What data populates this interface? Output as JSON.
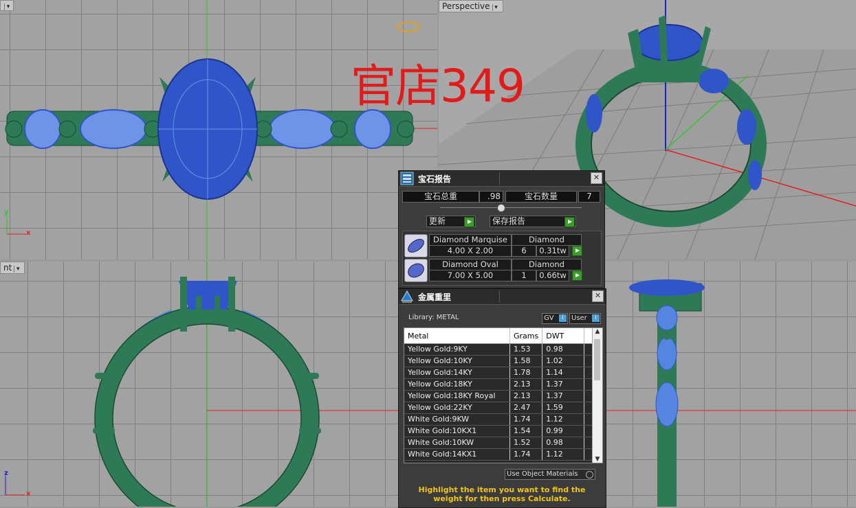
{
  "watermark": "官店349",
  "viewports": {
    "perspective_label": "Perspective",
    "front_label": "nt",
    "axis_x": "x",
    "axis_y": "y",
    "axis_z": "z"
  },
  "gem_report": {
    "title": "宝石报告",
    "total_weight_label": "宝石总重",
    "total_weight_value": ".98",
    "count_label": "宝石数量",
    "count_value": "7",
    "update_label": "更新",
    "save_label": "保存报告",
    "gems": [
      {
        "name": "Diamond Marquise",
        "material": "Diamond",
        "size": "4.00 X 2.00",
        "qty": "6",
        "weight": "0.31tw"
      },
      {
        "name": "Diamond Oval",
        "material": "Diamond",
        "size": "7.00 X 5.00",
        "qty": "1",
        "weight": "0.66tw"
      }
    ]
  },
  "metal_weight": {
    "title": "金属重里",
    "library_label": "Library: METAL",
    "gv_label": "GV",
    "user_label": "User",
    "columns": [
      "Metal",
      "Grams",
      "DWT"
    ],
    "rows": [
      [
        "Yellow Gold:9KY",
        "1.53",
        "0.98"
      ],
      [
        "Yellow Gold:10KY",
        "1.58",
        "1.02"
      ],
      [
        "Yellow Gold:14KY",
        "1.78",
        "1.14"
      ],
      [
        "Yellow Gold:18KY",
        "2.13",
        "1.37"
      ],
      [
        "Yellow Gold:18KY Royal",
        "2.13",
        "1.37"
      ],
      [
        "Yellow Gold:22KY",
        "2.47",
        "1.59"
      ],
      [
        "White Gold:9KW",
        "1.74",
        "1.12"
      ],
      [
        "White Gold:10KX1",
        "1.54",
        "0.99"
      ],
      [
        "White Gold:10KW",
        "1.52",
        "0.98"
      ],
      [
        "White Gold:14KX1",
        "1.74",
        "1.12"
      ]
    ],
    "use_object_label": "Use Object Materials",
    "hint": "Highlight the item you want to find the weight for then press Calculate."
  },
  "colors": {
    "ring_green": "#2e7a57",
    "gem_blue": "#2f55c8",
    "gem_light": "#6e94e8",
    "hint_yellow": "#f0c419",
    "watermark_red": "#e21a1a"
  }
}
